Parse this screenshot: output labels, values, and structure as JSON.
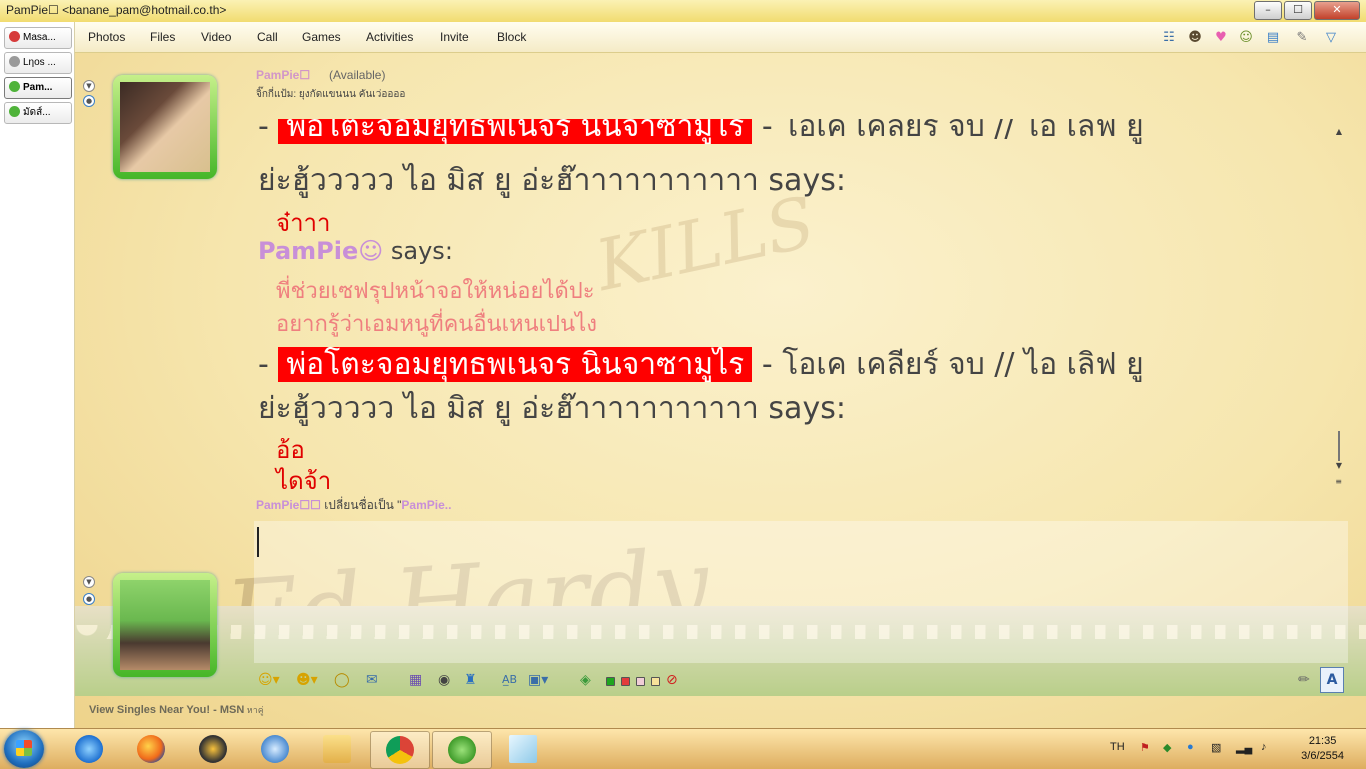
{
  "window": {
    "title": "PamPie☐ <banane_pam@hotmail.co.th>",
    "minimize": "–",
    "maximize": "☐",
    "close": "✕"
  },
  "contacts": [
    {
      "label": "Masa...",
      "status_color": "#d63b3b"
    },
    {
      "label": "Lηos ...",
      "status_color": "#9a9a9a"
    },
    {
      "label": "Pam...",
      "status_color": "#4fb33a"
    },
    {
      "label": "มัดส์...",
      "status_color": "#4fb33a"
    }
  ],
  "menu": [
    "Photos",
    "Files",
    "Video",
    "Call",
    "Games",
    "Activities",
    "Invite",
    "Block"
  ],
  "header": {
    "name": "PamPie☐",
    "status": "(Available)",
    "psm": "จิ๊กกี่แป้ม:  ยุงกัดแขนนน คันเว่ออออ"
  },
  "chat": {
    "top_partial": {
      "dash": "-",
      "nickname": "พ่อโตะจอมยุทธพเนจร นินจาซามูไร",
      "tail": " - โอเค เคลียร์ จบ // ไอ เลิฟ ยู"
    },
    "line1": "ย่ะฮู้ววววว ไอ มิส ยู อ่ะฮ๊าาาาาาาาาาา says:",
    "msg1": "จ๋าาา",
    "pam_nick": "PamPie☺",
    "pam_says": " says:",
    "msg2": "พี่ช่วยเซฟรุปหน้าจอให้หน่อยได้ปะ",
    "msg3": "อยากรู้ว่าเอมหนูที่คนอื่นเหนเปนไง",
    "entry2": {
      "dash": "-",
      "nickname": "พ่อโตะจอมยุทธพเนจร นินจาซามูไร",
      "tail": " - โอเค เคลียร์ จบ // ไอ เลิฟ ยู"
    },
    "line2": "ย่ะฮู้ววววว ไอ มิส ยู อ่ะฮ๊าาาาาาาาาาา says:",
    "msg4": "อ้อ",
    "msg5": "ไดจ้า"
  },
  "notice": {
    "who": "PamPie☐☐",
    "text": " เปลี่ยนชื่อเป็น \"",
    "new": "PamPie.."
  },
  "compose": {
    "value": ""
  },
  "format_toolbar": {
    "font_button": "A"
  },
  "ad": {
    "text": "View Singles Near You! - MSN",
    "suffix": " หาคู่"
  },
  "background": {
    "brand": "Ed Hardy",
    "tag": "KILLS"
  },
  "taskbar": {
    "language": "TH",
    "time": "21:35",
    "date": "3/6/2554"
  },
  "colors": {
    "red_highlight": "#ff0000",
    "nick_pink": "#c88fd8",
    "msg_red": "#e00000",
    "msg_pink": "#ef7f7f"
  }
}
